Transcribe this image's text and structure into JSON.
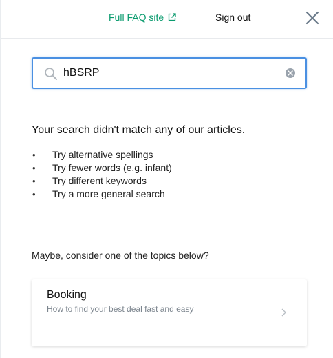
{
  "header": {
    "faq_link_label": "Full FAQ site",
    "faq_link_icon": "external-link-icon",
    "sign_out_label": "Sign out",
    "close_icon": "close-icon"
  },
  "search": {
    "value": "hBSRP",
    "placeholder": "",
    "search_icon": "search-icon",
    "clear_icon": "clear-icon"
  },
  "results": {
    "no_match_message": "Your search didn't match any of our articles.",
    "tips": [
      "Try alternative spellings",
      "Try fewer words (e.g. infant)",
      "Try different keywords",
      "Try a more general search"
    ]
  },
  "suggestions": {
    "heading": "Maybe, consider one of the topics below?",
    "topics": [
      {
        "title": "Booking",
        "description": "How to find your best deal fast and easy"
      }
    ]
  },
  "colors": {
    "accent_green": "#0a9b6e",
    "focus_blue": "#4a90e2",
    "muted_text": "#7c858e"
  }
}
